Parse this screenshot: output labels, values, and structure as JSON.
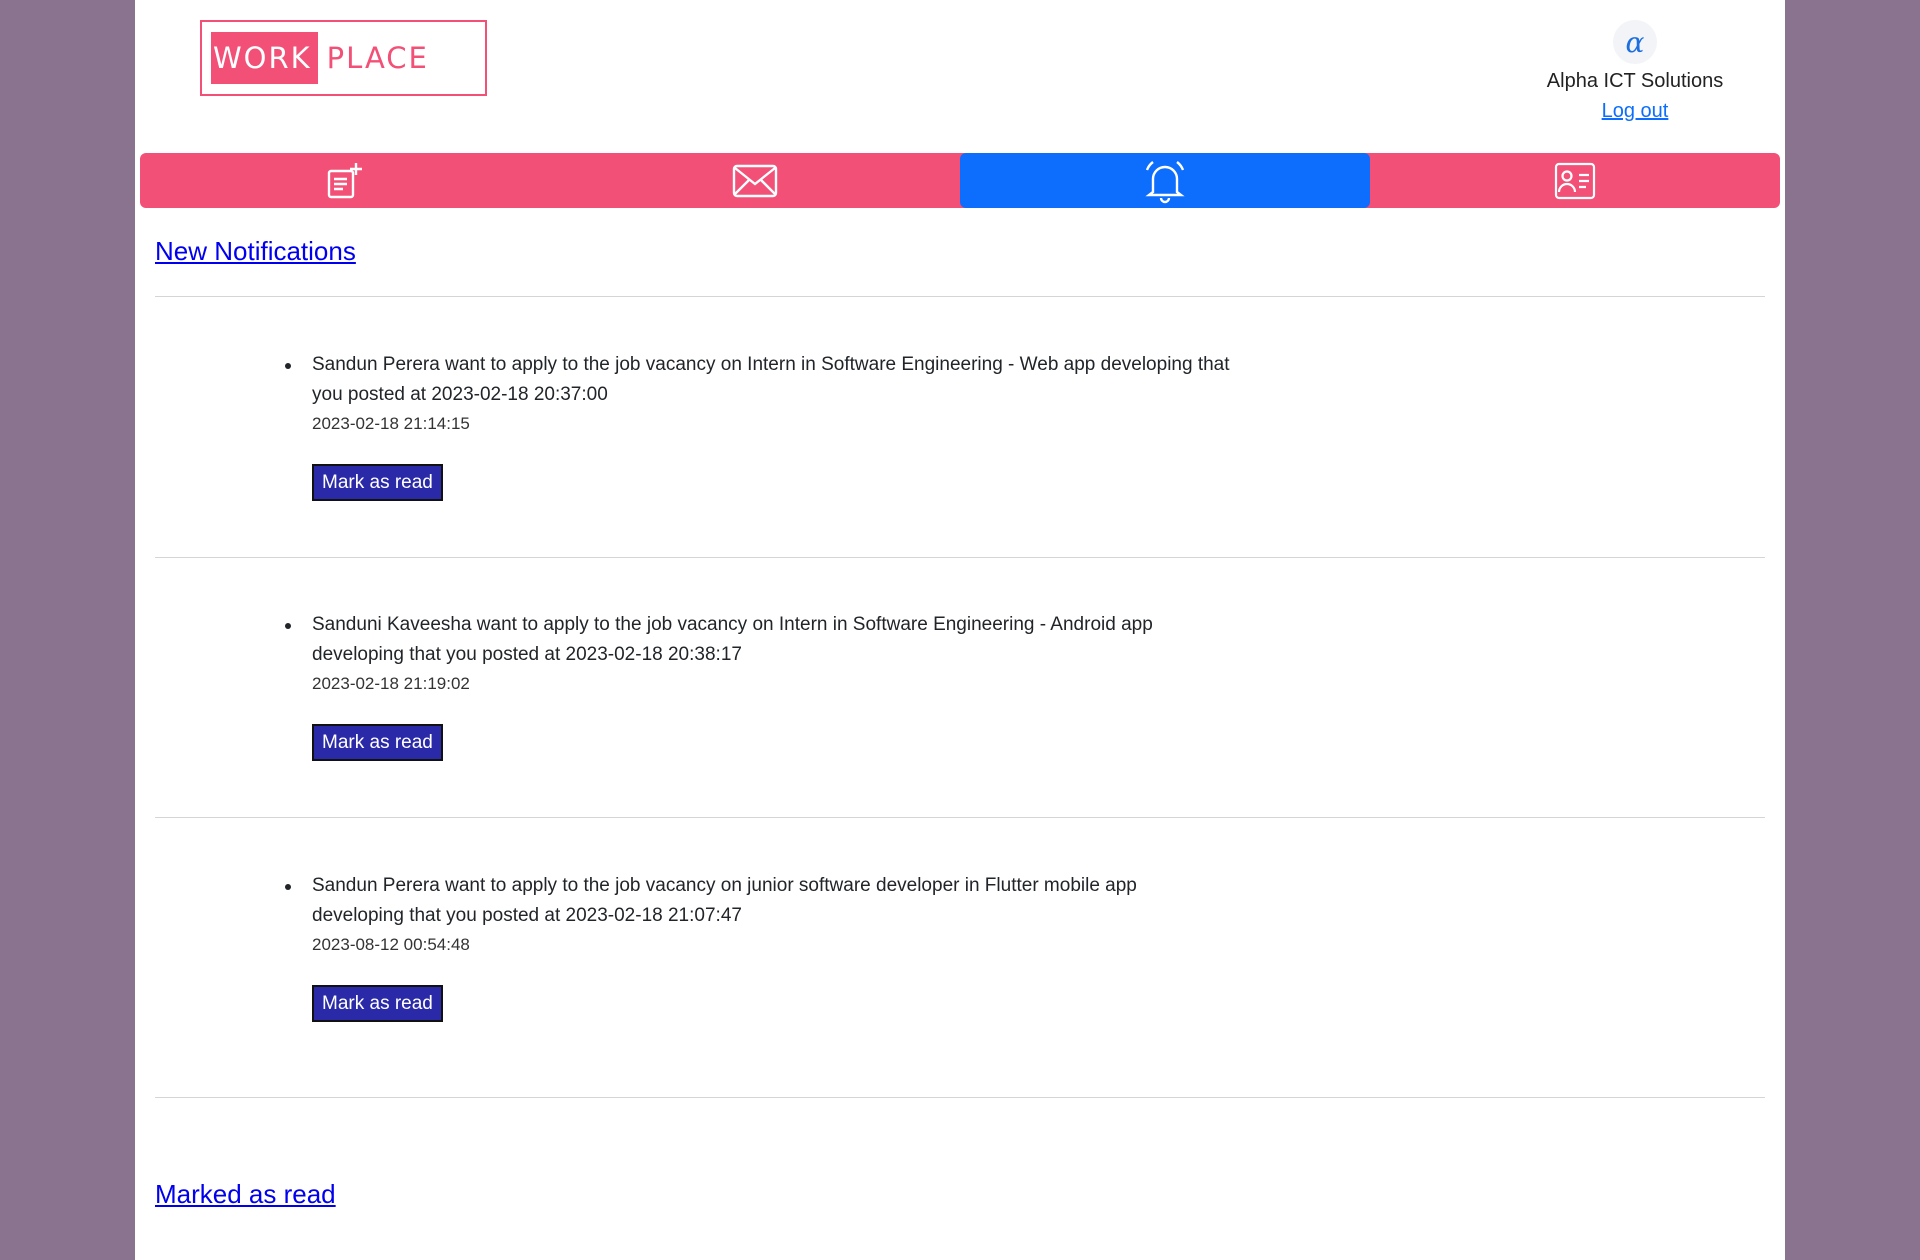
{
  "header": {
    "logo_left": "WORK",
    "logo_right": "PLACE",
    "company_logo_glyph": "α",
    "company_name": "Alpha ICT Solutions",
    "logout_label": "Log out"
  },
  "nav": {
    "items": [
      {
        "icon": "post-add-icon",
        "active": false
      },
      {
        "icon": "envelope-icon",
        "active": false
      },
      {
        "icon": "bell-icon",
        "active": true
      },
      {
        "icon": "person-card-icon",
        "active": false
      }
    ]
  },
  "sections": {
    "new_title": "New Notifications",
    "read_title": "Marked as read"
  },
  "notifications": [
    {
      "message": "Sandun Perera want to apply to the job vacancy on Intern in Software Engineering - Web app developing that you posted at 2023-02-18 20:37:00",
      "time": "2023-02-18 21:14:15",
      "button": "Mark as read"
    },
    {
      "message": "Sanduni Kaveesha want to apply to the job vacancy on Intern in Software Engineering - Android app developing that you posted at 2023-02-18 20:38:17",
      "time": "2023-02-18 21:19:02",
      "button": "Mark as read"
    },
    {
      "message": "Sandun Perera want to apply to the job vacancy on junior software developer in Flutter mobile app developing that you posted at 2023-02-18 21:07:47",
      "time": "2023-08-12 00:54:48",
      "button": "Mark as read"
    }
  ],
  "colors": {
    "page_bg": "#8a738e",
    "brand_pink": "#f25076",
    "active_blue": "#0d6efd",
    "button_blue": "#2a2aa8"
  }
}
